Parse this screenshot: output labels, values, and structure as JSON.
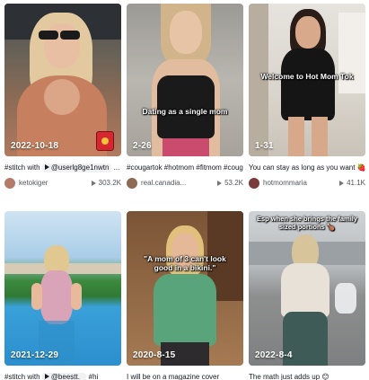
{
  "videos": [
    {
      "date": "2022-10-18",
      "overlay": "",
      "caption_prefix": "#stitch with",
      "caption_tag": "@userlg8ge1nwtn",
      "caption_suffix": "...",
      "author": "ketokiger",
      "plays": "303.2K",
      "avatar_color": "#b47b6a"
    },
    {
      "date": "2-26",
      "overlay": "Dating as a single mom",
      "caption": "#cougartok #hotmom #fitmom #cougar",
      "author": "real.canadia...",
      "plays": "53.2K",
      "avatar_color": "#8c6a55"
    },
    {
      "date": "1-31",
      "overlay": "Welcome to Hot Mom Tok",
      "caption": "You can stay as long as you want 🍓 check out my insta🔗 #fyp...",
      "author": "hotmommaria",
      "plays": "41.1K",
      "avatar_color": "#7a3b3b"
    },
    {
      "date": "2021-12-29",
      "overlay": "",
      "caption_prefix": "#stitch with",
      "caption_tag": "@beestt._",
      "caption_suffix": "#hi",
      "author": "",
      "plays": "",
      "avatar_color": "#6aa0c0"
    },
    {
      "date": "2020-8-15",
      "overlay": "\"A mom of 3 can't look good in a bikini.\"",
      "caption": "I will be on a magazine cover",
      "author": "",
      "plays": "",
      "avatar_color": "#c08a5a"
    },
    {
      "date": "2022-8-4",
      "overlay": "Esp when she brings the family sized portions 🍗",
      "caption": "The math just adds up 😊",
      "author": "",
      "plays": "",
      "avatar_color": "#556677"
    }
  ]
}
